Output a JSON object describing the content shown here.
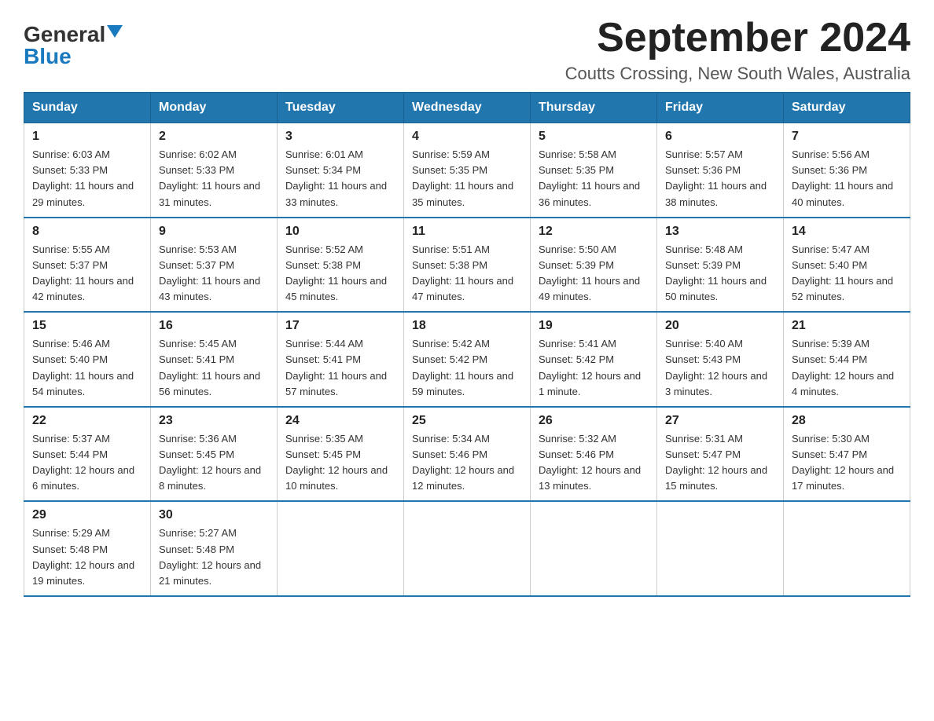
{
  "header": {
    "logo_general": "General",
    "logo_blue": "Blue",
    "month_title": "September 2024",
    "location": "Coutts Crossing, New South Wales, Australia"
  },
  "days_of_week": [
    "Sunday",
    "Monday",
    "Tuesday",
    "Wednesday",
    "Thursday",
    "Friday",
    "Saturday"
  ],
  "weeks": [
    [
      {
        "day": "1",
        "sunrise": "6:03 AM",
        "sunset": "5:33 PM",
        "daylight": "11 hours and 29 minutes."
      },
      {
        "day": "2",
        "sunrise": "6:02 AM",
        "sunset": "5:33 PM",
        "daylight": "11 hours and 31 minutes."
      },
      {
        "day": "3",
        "sunrise": "6:01 AM",
        "sunset": "5:34 PM",
        "daylight": "11 hours and 33 minutes."
      },
      {
        "day": "4",
        "sunrise": "5:59 AM",
        "sunset": "5:35 PM",
        "daylight": "11 hours and 35 minutes."
      },
      {
        "day": "5",
        "sunrise": "5:58 AM",
        "sunset": "5:35 PM",
        "daylight": "11 hours and 36 minutes."
      },
      {
        "day": "6",
        "sunrise": "5:57 AM",
        "sunset": "5:36 PM",
        "daylight": "11 hours and 38 minutes."
      },
      {
        "day": "7",
        "sunrise": "5:56 AM",
        "sunset": "5:36 PM",
        "daylight": "11 hours and 40 minutes."
      }
    ],
    [
      {
        "day": "8",
        "sunrise": "5:55 AM",
        "sunset": "5:37 PM",
        "daylight": "11 hours and 42 minutes."
      },
      {
        "day": "9",
        "sunrise": "5:53 AM",
        "sunset": "5:37 PM",
        "daylight": "11 hours and 43 minutes."
      },
      {
        "day": "10",
        "sunrise": "5:52 AM",
        "sunset": "5:38 PM",
        "daylight": "11 hours and 45 minutes."
      },
      {
        "day": "11",
        "sunrise": "5:51 AM",
        "sunset": "5:38 PM",
        "daylight": "11 hours and 47 minutes."
      },
      {
        "day": "12",
        "sunrise": "5:50 AM",
        "sunset": "5:39 PM",
        "daylight": "11 hours and 49 minutes."
      },
      {
        "day": "13",
        "sunrise": "5:48 AM",
        "sunset": "5:39 PM",
        "daylight": "11 hours and 50 minutes."
      },
      {
        "day": "14",
        "sunrise": "5:47 AM",
        "sunset": "5:40 PM",
        "daylight": "11 hours and 52 minutes."
      }
    ],
    [
      {
        "day": "15",
        "sunrise": "5:46 AM",
        "sunset": "5:40 PM",
        "daylight": "11 hours and 54 minutes."
      },
      {
        "day": "16",
        "sunrise": "5:45 AM",
        "sunset": "5:41 PM",
        "daylight": "11 hours and 56 minutes."
      },
      {
        "day": "17",
        "sunrise": "5:44 AM",
        "sunset": "5:41 PM",
        "daylight": "11 hours and 57 minutes."
      },
      {
        "day": "18",
        "sunrise": "5:42 AM",
        "sunset": "5:42 PM",
        "daylight": "11 hours and 59 minutes."
      },
      {
        "day": "19",
        "sunrise": "5:41 AM",
        "sunset": "5:42 PM",
        "daylight": "12 hours and 1 minute."
      },
      {
        "day": "20",
        "sunrise": "5:40 AM",
        "sunset": "5:43 PM",
        "daylight": "12 hours and 3 minutes."
      },
      {
        "day": "21",
        "sunrise": "5:39 AM",
        "sunset": "5:44 PM",
        "daylight": "12 hours and 4 minutes."
      }
    ],
    [
      {
        "day": "22",
        "sunrise": "5:37 AM",
        "sunset": "5:44 PM",
        "daylight": "12 hours and 6 minutes."
      },
      {
        "day": "23",
        "sunrise": "5:36 AM",
        "sunset": "5:45 PM",
        "daylight": "12 hours and 8 minutes."
      },
      {
        "day": "24",
        "sunrise": "5:35 AM",
        "sunset": "5:45 PM",
        "daylight": "12 hours and 10 minutes."
      },
      {
        "day": "25",
        "sunrise": "5:34 AM",
        "sunset": "5:46 PM",
        "daylight": "12 hours and 12 minutes."
      },
      {
        "day": "26",
        "sunrise": "5:32 AM",
        "sunset": "5:46 PM",
        "daylight": "12 hours and 13 minutes."
      },
      {
        "day": "27",
        "sunrise": "5:31 AM",
        "sunset": "5:47 PM",
        "daylight": "12 hours and 15 minutes."
      },
      {
        "day": "28",
        "sunrise": "5:30 AM",
        "sunset": "5:47 PM",
        "daylight": "12 hours and 17 minutes."
      }
    ],
    [
      {
        "day": "29",
        "sunrise": "5:29 AM",
        "sunset": "5:48 PM",
        "daylight": "12 hours and 19 minutes."
      },
      {
        "day": "30",
        "sunrise": "5:27 AM",
        "sunset": "5:48 PM",
        "daylight": "12 hours and 21 minutes."
      },
      null,
      null,
      null,
      null,
      null
    ]
  ],
  "labels": {
    "sunrise_prefix": "Sunrise: ",
    "sunset_prefix": "Sunset: ",
    "daylight_prefix": "Daylight: "
  }
}
